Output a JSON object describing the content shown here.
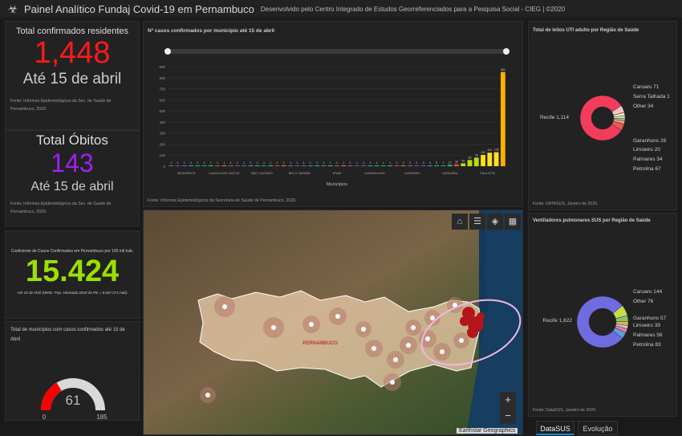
{
  "header": {
    "title": "Painel Analítico Fundaj Covid-19 em Pernambuco",
    "subtitle": "Desenvolvido pelo Centro Integrado de Estudos Georreferenciados para a Pesquisa Social - CIEG | ©2020"
  },
  "confirmed": {
    "label": "Total confirmados residentes",
    "value": "1,448",
    "date": "Até 15 de abril",
    "source": "Fonte: Informes Epidemiológicos da Sec. de Saúde de Pernambuco, 2020.",
    "color": "#ff1a1a"
  },
  "deaths": {
    "label": "Total Óbitos",
    "value": "143",
    "date": "Até 15 de abril",
    "source": "Fonte: Informes Epidemiológicos da Sec. de Saúde de Pernambuco, 2020.",
    "color": "#a020f0"
  },
  "coef": {
    "label": "Coeficiente de Casos Confirmados em Pernambuco por 100 mil hab.",
    "value": "15.424",
    "note": "Até 15 de Abril (IBGE: Pop. estimada 2019 de PE = 9.557.071 hab)",
    "color": "#9be000"
  },
  "municipios": {
    "label": "Total de municípios com casos confirmados até 15 de Abril",
    "value": "61",
    "min": "0",
    "max": "185",
    "fraction": 0.33
  },
  "bar_panel": {
    "title": "Nº casos confirmados por município até 15 de abril",
    "source": "Fonte: Informes Epidemiológicos da Secretaria de Saúde de Pernambuco, 2020."
  },
  "uti_panel": {
    "title": "Total de leitos UTI adulto por Região de Saúde",
    "source": "Fonte: DATASUS, Janeiro de 2020."
  },
  "vent_panel": {
    "title": "Ventiladores pulmonares SUS por Região de Saúde",
    "source": "Fonte: DataSUS, Janeiro de 2020."
  },
  "map": {
    "state_label": "PERNAMBUCO",
    "attribution": "Earthstar Geographics",
    "zoom_in": "+",
    "zoom_out": "−"
  },
  "tabs": [
    "DataSUS",
    "Evolução"
  ],
  "chart_data": [
    {
      "type": "bar",
      "title": "Nº casos confirmados por município até 15 de abril",
      "xlabel": "Municípios",
      "ylabel": "",
      "ylim": [
        0,
        900
      ],
      "yticks": [
        0,
        100,
        200,
        300,
        400,
        500,
        600,
        700,
        800,
        900
      ],
      "tick_labels": [
        "BEZERROS",
        "LAGOA DOS GATOS",
        "SÃO CAITANO",
        "BELO JARDIM",
        "IPUBI",
        "GARANHUNS",
        "LIMOEIRO",
        "CARUARU",
        "PAULISTA"
      ],
      "values": [
        1,
        1,
        1,
        1,
        1,
        1,
        1,
        1,
        1,
        1,
        1,
        1,
        1,
        1,
        1,
        1,
        1,
        1,
        1,
        1,
        1,
        1,
        1,
        1,
        1,
        1,
        1,
        1,
        1,
        1,
        1,
        1,
        1,
        1,
        1,
        2,
        2,
        2,
        3,
        4,
        5,
        7,
        12,
        18,
        26,
        56,
        78,
        102,
        122,
        126,
        851
      ],
      "data_labels": [
        "1",
        "1",
        "1",
        "1",
        "1",
        "1",
        "1",
        "1",
        "1",
        "1",
        "1",
        "1",
        "1",
        "1",
        "1",
        "1",
        "1",
        "1",
        "1",
        "1",
        "1",
        "1",
        "1",
        "1",
        "1",
        "1",
        "1",
        "1",
        "1",
        "1",
        "1",
        "1",
        "1",
        "1",
        "1",
        "2",
        "2",
        "2",
        "3",
        "4",
        "5",
        "7",
        "12",
        "18",
        "26",
        "56",
        "78",
        "102",
        "122",
        "126",
        "851"
      ]
    },
    {
      "type": "pie",
      "title": "Total de leitos UTI adulto por Região de Saúde",
      "labels": [
        "Recife",
        "Caruaru",
        "Serra Talhada",
        "Other",
        "Garanhuns",
        "Limoeiro",
        "Palmares",
        "Petrolina"
      ],
      "values": [
        1114,
        71,
        1,
        34,
        26,
        20,
        34,
        67
      ],
      "colors": [
        "#f23c5c",
        "#f5c6c6",
        "#c9d9e8",
        "#f1e3b8",
        "#dfe6a0",
        "#aac5e8",
        "#f0a36e",
        "#e35b5b"
      ]
    },
    {
      "type": "pie",
      "title": "Ventiladores pulmonares SUS por Região de Saúde",
      "labels": [
        "Recife",
        "Caruaru",
        "Other",
        "Garanhuns",
        "Limoeiro",
        "Palmares",
        "Petrolina"
      ],
      "values": [
        1622,
        144,
        76,
        57,
        39,
        56,
        83
      ],
      "colors": [
        "#6f6be0",
        "#c7db4b",
        "#8ac06c",
        "#e4b24f",
        "#b6d9f0",
        "#e87a98",
        "#5aa0e0"
      ]
    }
  ]
}
